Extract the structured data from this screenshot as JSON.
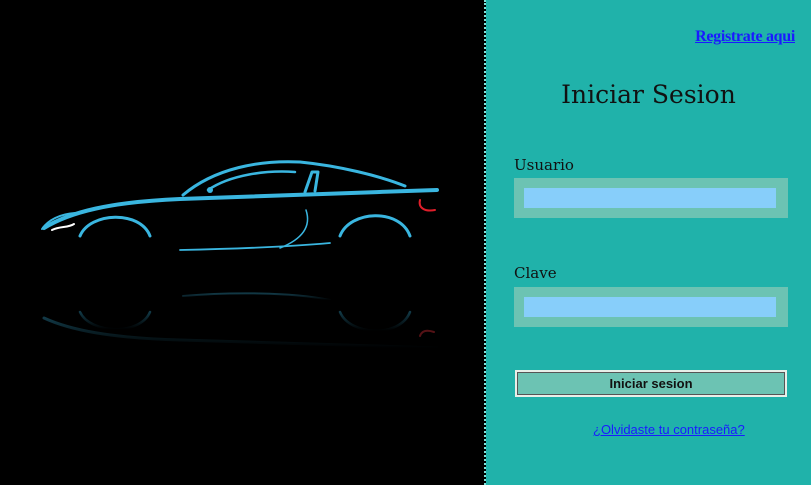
{
  "header": {
    "register_link": "Registrate aqui"
  },
  "login": {
    "title": "Iniciar Sesion",
    "username_label": "Usuario",
    "username_value": "",
    "password_label": "Clave",
    "password_value": "",
    "submit_label": "Iniciar sesion",
    "forgot_link": "¿Olvidaste tu contraseña?"
  },
  "colors": {
    "panel_bg": "#20b2aa",
    "input_fill": "#87cefa",
    "input_frame": "#6cc3b3",
    "link": "#1a1aff",
    "car_outline": "#3ab6e0",
    "car_accent": "#e01e2a"
  },
  "hero": {
    "image": "sports-car-silhouette-with-reflection"
  }
}
